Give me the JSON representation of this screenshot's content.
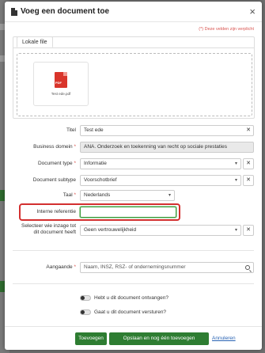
{
  "modal": {
    "title": "Voeg een document toe",
    "required_note": "(*) Deze velden zijn verplicht",
    "close_symbol": "×"
  },
  "upload": {
    "tab_label": "Lokale file",
    "file_name": "Test ede.pdf",
    "file_type": "PDF"
  },
  "form": {
    "title": {
      "label": "Titel",
      "value": "Test ede"
    },
    "business_domain": {
      "label": "Business domein",
      "required": "*",
      "value": "ANA. Onderzoek en toekenning van recht op sociale prestaties"
    },
    "document_type": {
      "label": "Document type",
      "required": "*",
      "value": "Informatie"
    },
    "document_subtype": {
      "label": "Document subtype",
      "value": "Voorschotbrief"
    },
    "language": {
      "label": "Taal",
      "required": "*",
      "value": "Nederlands"
    },
    "internal_reference": {
      "label": "Interne referentie",
      "value": ""
    },
    "visibility": {
      "label_line1": "Selecteer wie inzage tot",
      "label_line2": "dit document heeft",
      "value": "Geen vertrouwelijkheid"
    },
    "concerning": {
      "label": "Aangaande",
      "required": "*",
      "placeholder": "Naam, INSZ, RSZ- of ondernemingsnummer"
    }
  },
  "toggles": {
    "received": "Hebt u dit document ontvangen?",
    "send": "Gaat u dit document versturen?"
  },
  "footer": {
    "add_label": "Toevoegen",
    "save_add_another_label": "Opslaan en nog één toevoegen",
    "cancel_label": "Annuleren"
  },
  "colors": {
    "primary_green": "#2e7d32",
    "required_red": "#d9534f",
    "highlight_red": "#d32f2f",
    "link_blue": "#2a64b4"
  }
}
